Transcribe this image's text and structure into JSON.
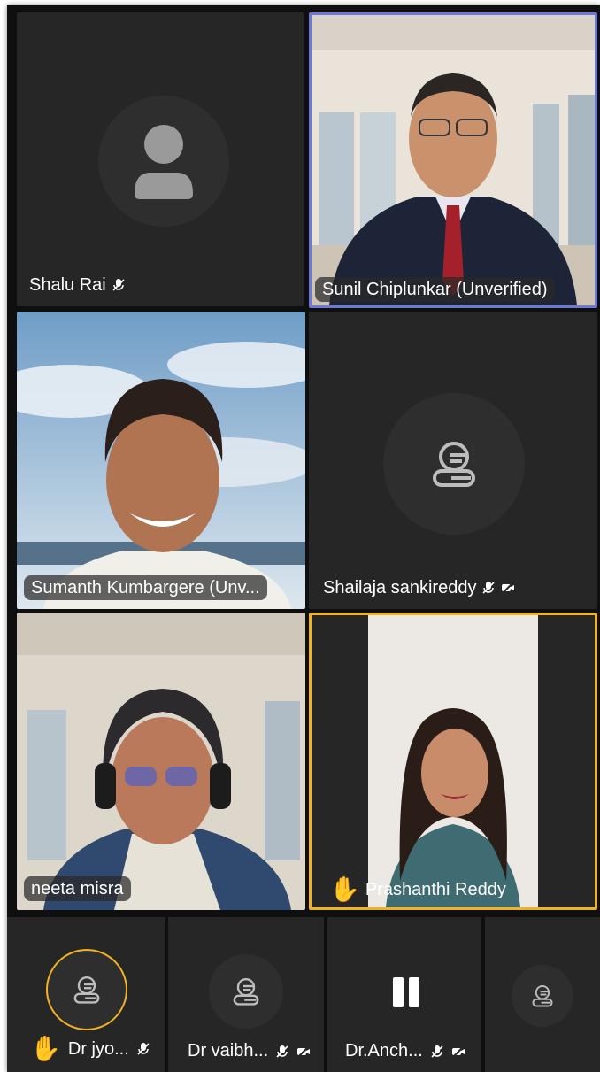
{
  "tiles": {
    "shalu": {
      "name": "Shalu Rai"
    },
    "sunil": {
      "name": "Sunil Chiplunkar (Unverified)"
    },
    "sumanth": {
      "name": "Sumanth Kumbargere (Unv..."
    },
    "shailaja": {
      "name": "Shailaja sankireddy"
    },
    "neeta": {
      "name": "neeta misra"
    },
    "prashanthi": {
      "name": "Prashanthi Reddy"
    }
  },
  "bottom": [
    {
      "name": "Dr jyo..."
    },
    {
      "name": "Dr vaibh..."
    },
    {
      "name": "Dr.Anch..."
    },
    {
      "name": ""
    }
  ],
  "colors": {
    "active_speaker": "#6e78d6",
    "raised_hand": "#f0b323",
    "tile_bg": "#262626",
    "frame_bg": "#0f0f0f"
  },
  "icons": [
    "mic-muted-icon",
    "camera-off-icon",
    "raised-hand-icon",
    "pause-icon",
    "person-icon",
    "ms-guest-icon"
  ]
}
